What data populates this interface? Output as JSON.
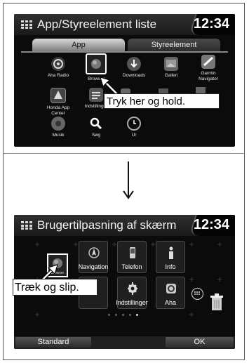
{
  "screen1": {
    "title": "App/Styreelement liste",
    "clock": "12:34",
    "tabs": [
      "App",
      "Styreelement"
    ],
    "apps": [
      {
        "label": "Aha Radio",
        "icon": "aha-radio-icon"
      },
      {
        "label": "Browser",
        "icon": "browser-icon"
      },
      {
        "label": "Downloads",
        "icon": "downloads-icon"
      },
      {
        "label": "Galleri",
        "icon": "gallery-icon"
      },
      {
        "label": "Garmin Navigator",
        "icon": "garmin-icon"
      },
      {
        "label": "Honda App Center",
        "icon": "honda-app-center-icon"
      },
      {
        "label": "Indstillinger",
        "icon": "settings-icon"
      },
      {
        "label": "Musik",
        "icon": "music-icon"
      },
      {
        "label": "Søg",
        "icon": "search-icon"
      },
      {
        "label": "Ur",
        "icon": "clock-icon"
      }
    ],
    "callout": "Tryk her og hold."
  },
  "screen2": {
    "title": "Brugertilpasning af skærm",
    "clock": "12:34",
    "tiles": [
      "Navigation",
      "Telefon",
      "Info",
      "Indstillinger",
      "Aha"
    ],
    "dragged_label": "Browser",
    "callout": "Træk og slip.",
    "buttons": {
      "left": "Standard",
      "right": "OK"
    }
  }
}
